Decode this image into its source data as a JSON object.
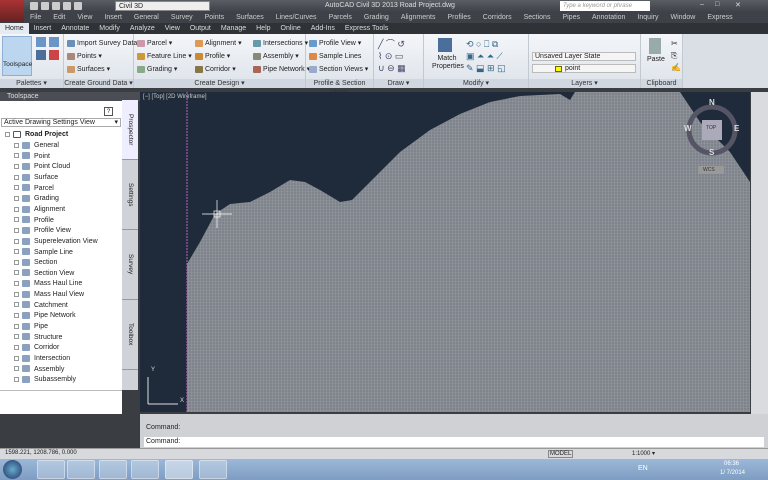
{
  "titlebar": {
    "workspace": "Civil 3D",
    "title": "AutoCAD Civil 3D 2013   Road Project.dwg",
    "search_placeholder": "Type a keyword or phrase"
  },
  "menubar": [
    "File",
    "Edit",
    "View",
    "Insert",
    "General",
    "Survey",
    "Points",
    "Surfaces",
    "Lines/Curves",
    "Parcels",
    "Grading",
    "Alignments",
    "Profiles",
    "Corridors",
    "Sections",
    "Pipes",
    "Annotation",
    "Inquiry",
    "Window",
    "Express"
  ],
  "tabs": [
    "Home",
    "Insert",
    "Annotate",
    "Modify",
    "Analyze",
    "View",
    "Output",
    "Manage",
    "Help",
    "Online",
    "Add-Ins",
    "Express Tools"
  ],
  "ribbon": {
    "palettes": {
      "toolspace": "Toolspace",
      "label": "Palettes ▾"
    },
    "ground": {
      "items": [
        "Import Survey Data",
        "Points ▾",
        "Surfaces ▾"
      ],
      "label": "Create Ground Data ▾"
    },
    "design": {
      "items": [
        "Parcel ▾",
        "Feature Line ▾",
        "Grading ▾",
        "Alignment ▾",
        "Profile ▾",
        "Corridor ▾",
        "Intersections ▾",
        "Assembly ▾",
        "Pipe Network ▾"
      ],
      "label": "Create Design ▾"
    },
    "profile": {
      "items": [
        "Profile View ▾",
        "Sample Lines",
        "Section Views ▾"
      ],
      "label": "Profile & Section Views"
    },
    "draw": {
      "label": "Draw ▾"
    },
    "modify": {
      "match": "Match Properties",
      "label": "Modify ▾"
    },
    "layers": {
      "state": "Unsaved Layer State",
      "layer": "point",
      "label": "Layers ▾"
    },
    "clipboard": {
      "paste": "Paste",
      "label": "Clipboard"
    }
  },
  "toolspace": {
    "title": "Toolspace",
    "view": "Active Drawing Settings View",
    "root": "Road Project",
    "items": [
      "General",
      "Point",
      "Point Cloud",
      "Surface",
      "Parcel",
      "Grading",
      "Alignment",
      "Profile",
      "Profile View",
      "Superelevation View",
      "Sample Line",
      "Section",
      "Section View",
      "Mass Haul Line",
      "Mass Haul View",
      "Catchment",
      "Pipe Network",
      "Pipe",
      "Structure",
      "Corridor",
      "Intersection",
      "Assembly",
      "Subassembly"
    ],
    "tabs": [
      "Prospector",
      "Settings",
      "Survey",
      "Toolbox"
    ]
  },
  "viewport": {
    "label": "[−] [Top] [2D Wireframe]",
    "compass": {
      "n": "N",
      "s": "S",
      "e": "E",
      "w": "W",
      "top": "TOP",
      "wcs": "WCS"
    },
    "ucs_y": "Y",
    "ucs_x": "X"
  },
  "command": {
    "history": "Command:",
    "prompt": "Command:"
  },
  "status": {
    "coords": "1598.221, 1208.786, 0.000",
    "model": "MODEL",
    "scale": "1:1000 ▾"
  },
  "taskbar": {
    "lang": "EN",
    "time": "06:36",
    "date": "1/ 7/2014"
  },
  "colors": {
    "viewport_bg": "#1f2b3a",
    "terrain": "#8c9098",
    "ribbon_active": "#bcd6ef"
  }
}
